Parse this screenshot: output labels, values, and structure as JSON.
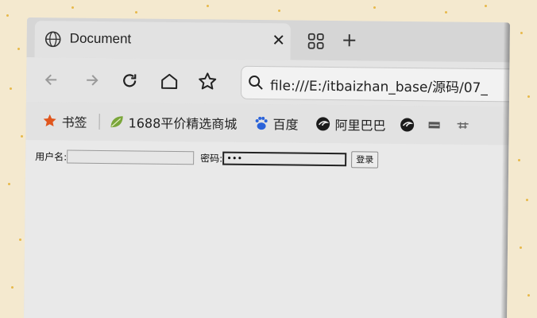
{
  "browser": {
    "tab": {
      "title": "Document"
    },
    "address_bar": {
      "url": "file:///E:/itbaizhan_base/源码/07_"
    },
    "bookmarks": [
      {
        "label": "书签",
        "icon": "star-icon"
      },
      {
        "label": "1688平价精选商城",
        "icon": "leaf-icon"
      },
      {
        "label": "百度",
        "icon": "baidu-paw-icon"
      },
      {
        "label": "阿里巴巴",
        "icon": "alibaba-icon"
      },
      {
        "label": "",
        "icon": "alibaba-icon"
      },
      {
        "label": "",
        "icon": "site-icon"
      },
      {
        "label": "",
        "icon": "site-icon"
      }
    ]
  },
  "login_form": {
    "username_label": "用户名:",
    "username_value": "",
    "password_label": "密码:",
    "password_value": "•••",
    "submit_label": "登录"
  },
  "colors": {
    "star": "#e0561d",
    "leaf": "#7aa63a",
    "baidu": "#2b63d9"
  }
}
